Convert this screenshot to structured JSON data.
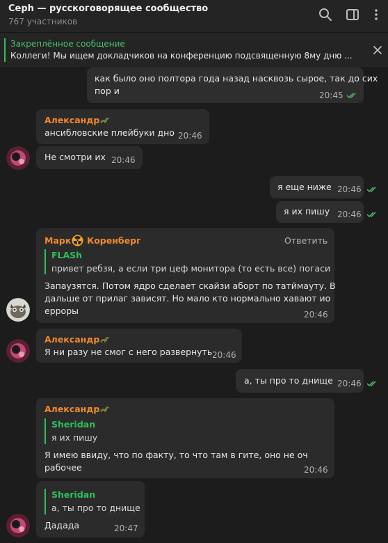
{
  "header": {
    "title": "Ceph — русскоговорящее сообщество",
    "subtitle": "767 участников",
    "search_icon": "search-icon",
    "sidebar_icon": "sidebar-toggle-icon",
    "menu_icon": "more-vertical-icon"
  },
  "pinned": {
    "label": "Закреплённое сообщение",
    "text": "Коллеги! Мы ищем докладчиков на конференцию подсвященную 8му дню ..."
  },
  "messages": {
    "m1": {
      "line1": "как было оно полтора года назад насквозь сырое, так до сих",
      "line2": "пор и",
      "time": "20:45"
    },
    "m2": {
      "sender": "Александр",
      "text": "ансибловские плейбуки дно",
      "time": "20:46"
    },
    "m3": {
      "text": "Не смотри их",
      "time": "20:46"
    },
    "m4": {
      "text": "я еще ниже",
      "time": "20:46"
    },
    "m5": {
      "text": "я их пишу",
      "time": "20:46"
    },
    "m6": {
      "sender_first": "Марк",
      "sender_last": "Коренберг",
      "reply_label": "Ответить",
      "quote_name": "FLASh",
      "quote_text": "привет ребзя, а если три цеф монитора (то есть все) погасит...",
      "line1": "Запаузятся. Потом ядро сделает скайзи аборт по татймауту. В",
      "line2": "дальше от прилаг зависят. Но мало кто нормально хавают ио",
      "line3": "ерроры",
      "time": "20:46"
    },
    "m7": {
      "sender": "Александр",
      "text": "Я ни разу не смог с него развернуть",
      "time": "20:46"
    },
    "m8": {
      "text": "а, ты про то днище",
      "time": "20:46"
    },
    "m9": {
      "sender": "Александр",
      "quote_name": "Sheridan",
      "quote_text": "я их пишу",
      "line1": "Я имею ввиду, что по факту, то что там в гите, оно не оч",
      "line2": "рабочее",
      "time": "20:46"
    },
    "m10": {
      "quote_name": "Sheridan",
      "quote_text": "а, ты про то днище",
      "text": "Дадада",
      "time": "20:47"
    }
  },
  "colors": {
    "accent_green": "#2fbf5c",
    "sender_orange": "#f0892c",
    "background": "#1c1c1c",
    "bubble": "#2b2b2b"
  }
}
